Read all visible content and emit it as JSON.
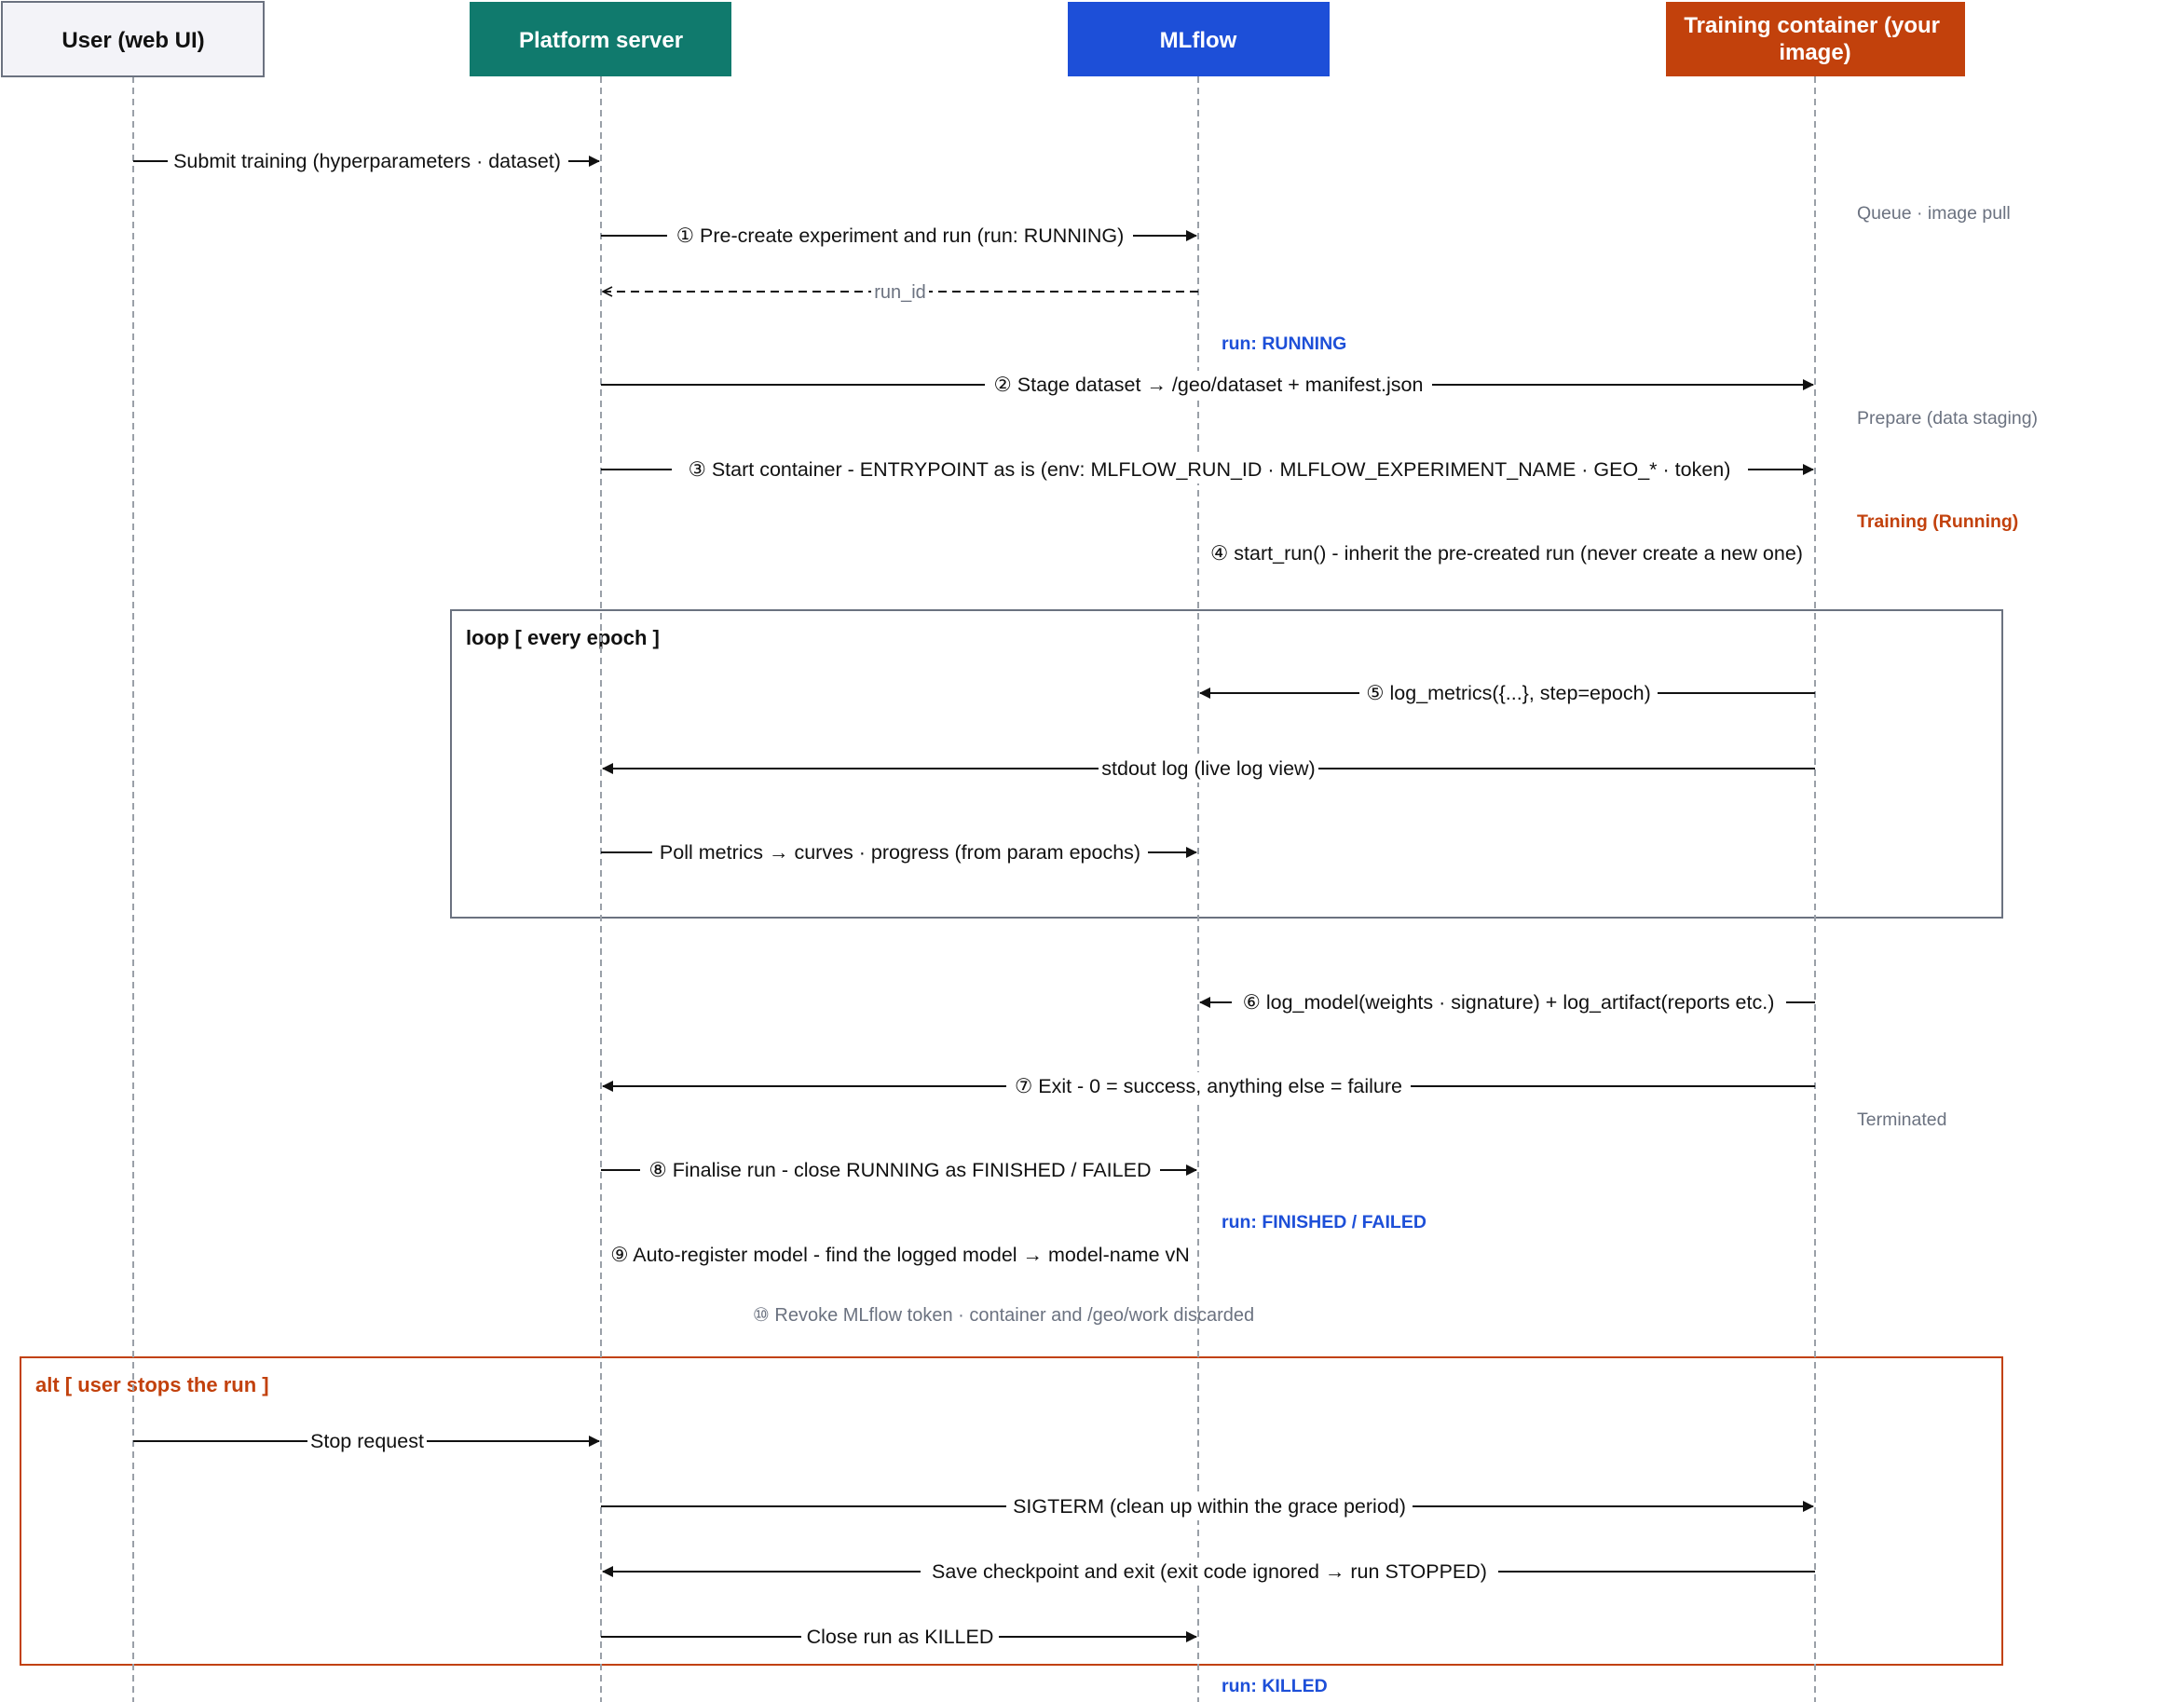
{
  "colors": {
    "user": "#f3f3f8",
    "platform": "#107a6d",
    "mlflow": "#1d4fd8",
    "container": "#c2410c",
    "run_state": "#1d4fd8",
    "training_state": "#c2410c",
    "note": "#6b7280",
    "loop_border": "#6b7280",
    "alt_border": "#c2410c"
  },
  "participants": [
    {
      "id": "user",
      "label": "User (web UI)"
    },
    {
      "id": "platform",
      "label": "Platform server"
    },
    {
      "id": "mlflow",
      "label": "MLflow"
    },
    {
      "id": "container",
      "label": "Training container (your image)"
    }
  ],
  "messages": [
    {
      "from": "user",
      "to": "platform",
      "label": "Submit training (hyperparameters · dataset)"
    },
    {
      "from": "platform",
      "to": "mlflow",
      "label": "① Pre-create experiment and run (run: RUNNING)"
    },
    {
      "from": "mlflow",
      "to": "platform",
      "label": "run_id",
      "reply": true
    },
    {
      "from": "platform",
      "to": "container",
      "label": "② Stage dataset → /geo/dataset + manifest.json"
    },
    {
      "from": "platform",
      "to": "container",
      "label": "③ Start container - ENTRYPOINT as is (env: MLFLOW_RUN_ID · MLFLOW_EXPERIMENT_NAME · GEO_* · token)"
    },
    {
      "from": "mlflow",
      "to": "container",
      "label": "④ start_run() - inherit the pre-created run (never create a new one)",
      "text_only": true
    },
    {
      "from": "container",
      "to": "mlflow",
      "label": "⑤ log_metrics({...}, step=epoch)"
    },
    {
      "from": "container",
      "to": "platform",
      "label": "stdout log (live log view)"
    },
    {
      "from": "platform",
      "to": "mlflow",
      "label": "Poll metrics → curves · progress (from param epochs)"
    },
    {
      "from": "container",
      "to": "mlflow",
      "label": "⑥ log_model(weights · signature) + log_artifact(reports etc.)"
    },
    {
      "from": "container",
      "to": "platform",
      "label": "⑦ Exit - 0 = success, anything else = failure"
    },
    {
      "from": "platform",
      "to": "mlflow",
      "label": "⑧ Finalise run - close RUNNING as FINISHED / FAILED"
    },
    {
      "from": "platform",
      "to": "mlflow",
      "label": "⑨ Auto-register model - find the logged model → model-name vN",
      "text_only": true
    },
    {
      "from": "platform",
      "to": "mlflow",
      "label": "⑩ Revoke MLflow token · container and /geo/work discarded",
      "text_only": true,
      "muted": true
    },
    {
      "from": "user",
      "to": "platform",
      "label": "Stop request"
    },
    {
      "from": "platform",
      "to": "container",
      "label": "SIGTERM (clean up within the grace period)"
    },
    {
      "from": "container",
      "to": "platform",
      "label": "Save checkpoint and exit (exit code ignored → run STOPPED)"
    },
    {
      "from": "platform",
      "to": "mlflow",
      "label": "Close run as KILLED"
    }
  ],
  "run_states": [
    "run: RUNNING",
    "run: FINISHED / FAILED",
    "run: KILLED"
  ],
  "container_notes": [
    "Queue · image pull",
    "Prepare (data staging)",
    "Training (Running)",
    "Terminated"
  ],
  "frames": {
    "loop": {
      "label": "loop [ every epoch ]"
    },
    "alt": {
      "label": "alt [ user stops the run ]"
    }
  }
}
